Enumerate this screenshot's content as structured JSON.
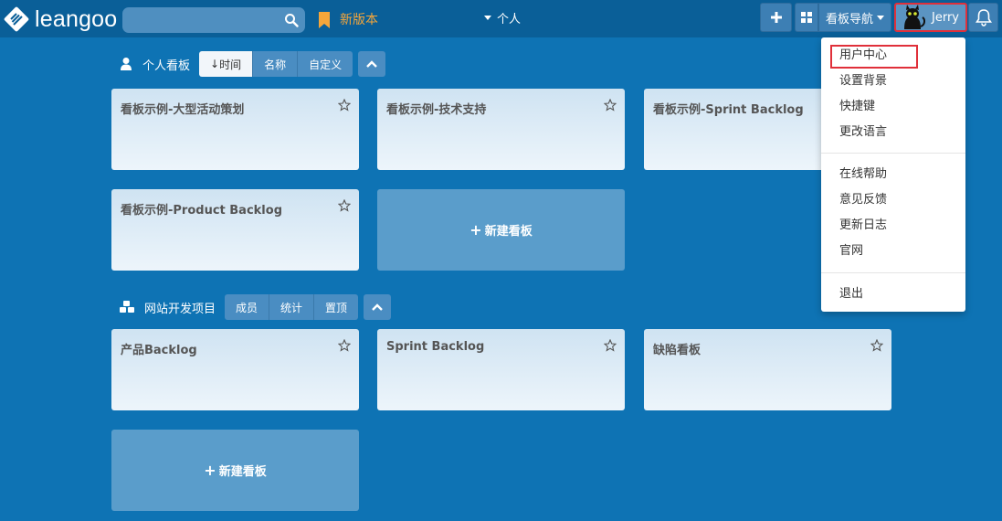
{
  "app": {
    "logo_text": "leangoo"
  },
  "header": {
    "search_placeholder": "",
    "new_version_label": "新版本",
    "personal_nav_label": "个人",
    "board_nav_label": "看板导航",
    "user_name": "Jerry"
  },
  "colors": {
    "topbar": "#0a5f98",
    "background": "#0e73b4",
    "new_version": "#f5a63a",
    "highlight": "#e0303a"
  },
  "personal_section": {
    "title": "个人看板",
    "sort_tabs": [
      {
        "label": "时间",
        "active": true
      },
      {
        "label": "名称",
        "active": false
      },
      {
        "label": "自定义",
        "active": false
      }
    ],
    "boards": [
      {
        "title": "看板示例-大型活动策划"
      },
      {
        "title": "看板示例-技术支持"
      },
      {
        "title": "看板示例-Sprint Backlog"
      },
      {
        "title": "看板示例-Product Backlog"
      }
    ],
    "new_board_label": "新建看板"
  },
  "project_section": {
    "title": "网站开发项目",
    "tabs": [
      {
        "label": "成员"
      },
      {
        "label": "统计"
      },
      {
        "label": "置顶"
      }
    ],
    "boards": [
      {
        "title": "产品Backlog"
      },
      {
        "title": "Sprint Backlog"
      },
      {
        "title": "缺陷看板"
      }
    ],
    "new_board_label": "新建看板"
  },
  "user_menu": {
    "group1": [
      "用户中心",
      "设置背景",
      "快捷键",
      "更改语言"
    ],
    "group2": [
      "在线帮助",
      "意见反馈",
      "更新日志",
      "官网"
    ],
    "group3": [
      "退出"
    ]
  }
}
